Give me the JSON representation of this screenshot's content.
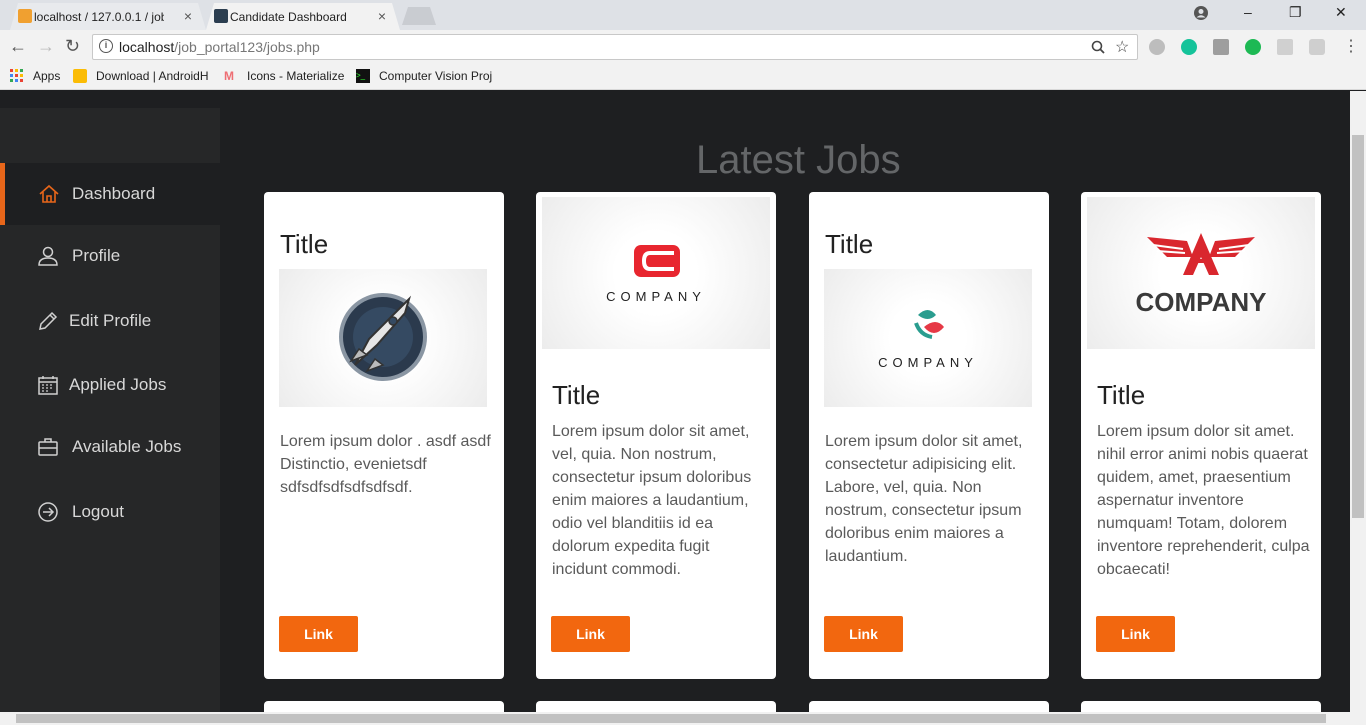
{
  "browser": {
    "tabs": [
      {
        "label": "localhost / 127.0.0.1 / job",
        "close": "×"
      },
      {
        "label": "Candidate Dashboard",
        "close": "×"
      }
    ],
    "url_host": "localhost",
    "url_path": "/job_portal123/jobs.php",
    "bookmarks": [
      {
        "label": "Apps",
        "icon": "apps-grid-icon",
        "color": "#e53935"
      },
      {
        "label": "Download | AndroidH",
        "icon": "download-icon",
        "color": "#fbbc05"
      },
      {
        "label": "Icons - Materialize",
        "icon": "materialize-icon",
        "color": "#ee6e73"
      },
      {
        "label": "Computer Vision Proj",
        "icon": "terminal-icon",
        "color": "#111111"
      }
    ],
    "window_controls": {
      "minimize": "–",
      "restore": "❐",
      "close": "✕"
    }
  },
  "sidebar": {
    "items": [
      {
        "label": "Dashboard",
        "icon": "home-icon"
      },
      {
        "label": "Profile",
        "icon": "user-icon"
      },
      {
        "label": "Edit Profile",
        "icon": "pencil-icon"
      },
      {
        "label": "Applied Jobs",
        "icon": "calendar-icon"
      },
      {
        "label": "Available Jobs",
        "icon": "briefcase-icon"
      },
      {
        "label": "Logout",
        "icon": "logout-icon"
      }
    ],
    "accent": "#e8661a"
  },
  "main": {
    "heading": "Latest Jobs",
    "cards": [
      {
        "title": "Title",
        "logo_text": "",
        "text": "Lorem ipsum dolor . asdf asdf Distinctio, evenietsdf sdfsdfsdfsdfsdfsdf.",
        "button": "Link"
      },
      {
        "title": "Title",
        "logo_text": "COMPANY",
        "text": "Lorem ipsum dolor sit amet, vel, quia. Non nostrum, consectetur ipsum doloribus enim maiores a laudantium, odio vel blanditiis id ea dolorum expedita fugit incidunt commodi.",
        "button": "Link"
      },
      {
        "title": "Title",
        "logo_text": "COMPANY",
        "text": "Lorem ipsum dolor sit amet, consectetur adipisicing elit. Labore, vel, quia. Non nostrum, consectetur ipsum doloribus enim maiores a laudantium.",
        "button": "Link"
      },
      {
        "title": "Title",
        "logo_text": "COMPANY",
        "text": "Lorem ipsum dolor sit amet. nihil error animi nobis quaerat quidem, amet, praesentium aspernatur inventore numquam! Totam, dolorem inventore reprehenderit, culpa obcaecati!",
        "button": "Link"
      }
    ],
    "button_color": "#f2670f"
  }
}
